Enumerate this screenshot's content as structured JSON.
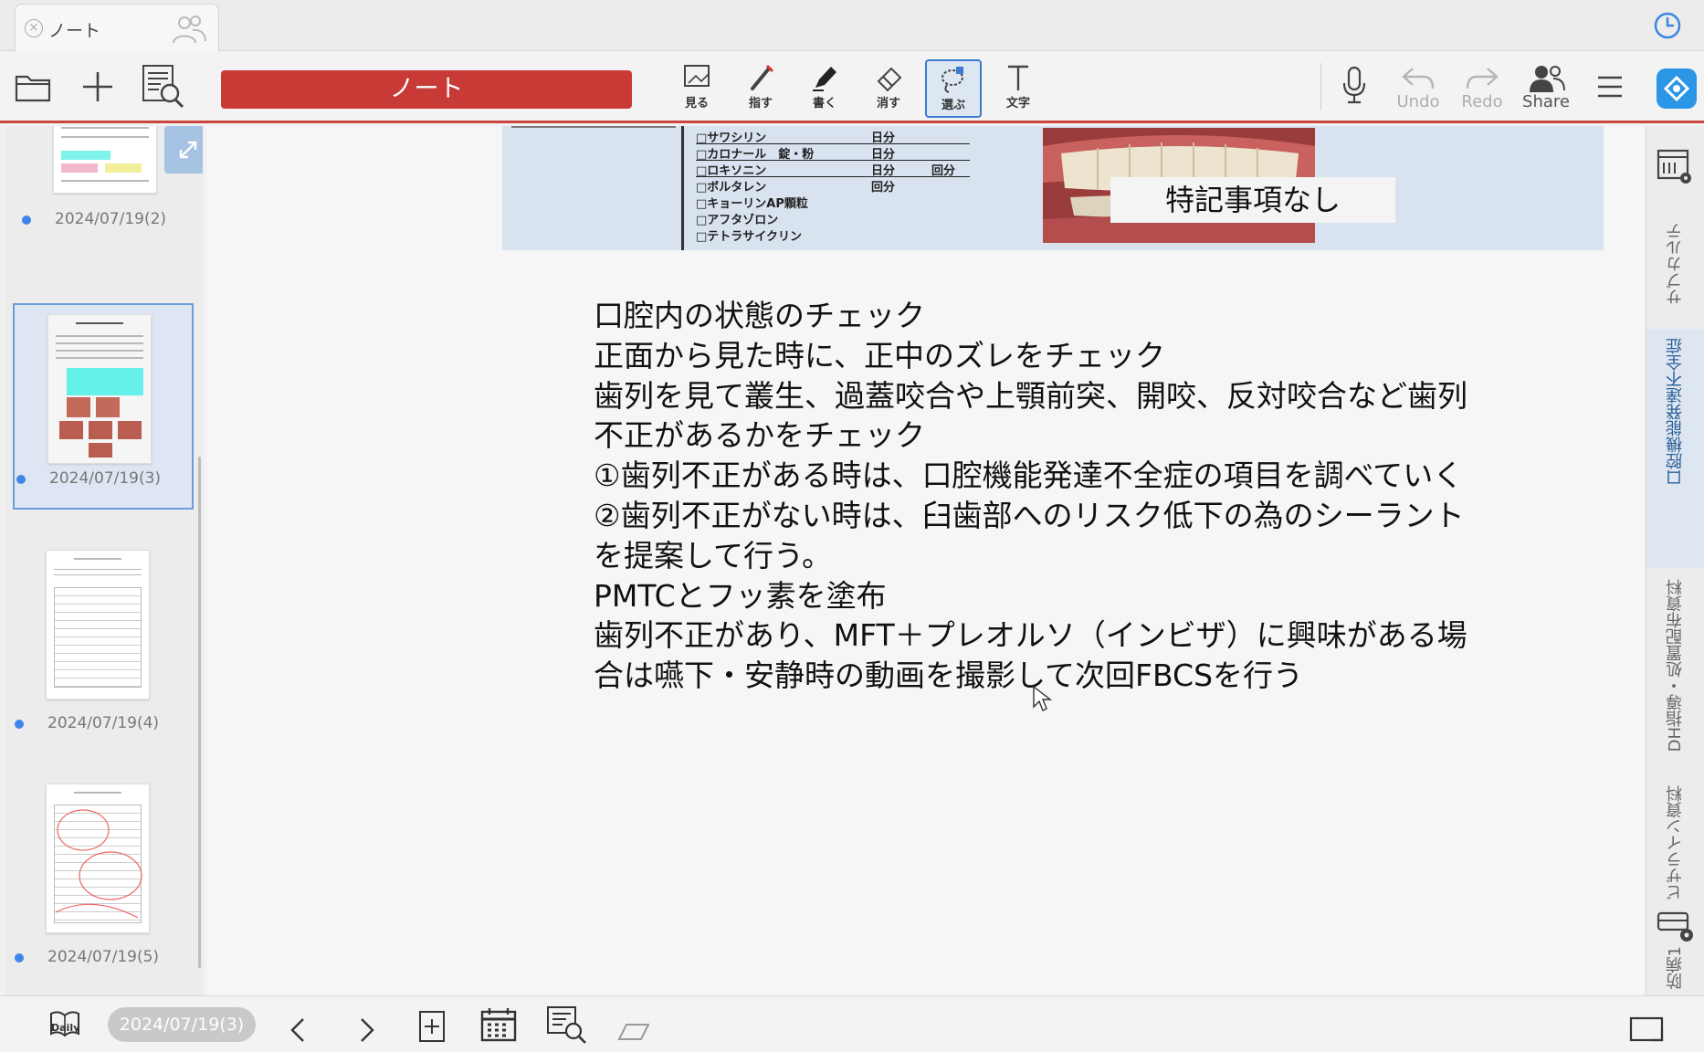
{
  "tab": {
    "title": "ノート"
  },
  "toolbar": {
    "notebook_label": "ノート",
    "tools": [
      {
        "label": "見る",
        "icon": "view-icon"
      },
      {
        "label": "指す",
        "icon": "laser-pointer-icon"
      },
      {
        "label": "書く",
        "icon": "pen-icon"
      },
      {
        "label": "消す",
        "icon": "eraser-icon"
      },
      {
        "label": "選ぶ",
        "icon": "lasso-select-icon",
        "active": true
      },
      {
        "label": "文字",
        "icon": "text-icon"
      }
    ],
    "undo_label": "Undo",
    "redo_label": "Redo",
    "share_label": "Share"
  },
  "sidebar": {
    "pages": [
      {
        "date": "2024/07/19(2)"
      },
      {
        "date": "2024/07/19(3)",
        "selected": true
      },
      {
        "date": "2024/07/19(4)"
      },
      {
        "date": "2024/07/19(5)"
      }
    ]
  },
  "canvas": {
    "meds": [
      {
        "name": "□サワシリン",
        "c2": "日分",
        "c3": ""
      },
      {
        "name": "□カロナール　錠・粉",
        "c2": "日分",
        "c3": ""
      },
      {
        "name": "□ロキソニン",
        "c2": "日分",
        "c3": "回分"
      },
      {
        "name": "□ボルタレン",
        "c2": "回分",
        "c3": ""
      },
      {
        "name": "□キョーリンAP顆粒",
        "c2": "",
        "c3": ""
      },
      {
        "name": "□アフタゾロン",
        "c2": "",
        "c3": ""
      },
      {
        "name": "□テトラサイクリン",
        "c2": "",
        "c3": ""
      }
    ],
    "note_box": "特記事項なし",
    "lines": [
      "口腔内の状態のチェック",
      "正面から見た時に、正中のズレをチェック",
      "歯列を見て叢生、過蓋咬合や上顎前突、開咬、反対咬合など歯列",
      "不正があるかをチェック",
      "①歯列不正がある時は、口腔機能発達不全症の項目を調べていく",
      "②歯列不正がない時は、臼歯部へのリスク低下の為のシーラント",
      "を提案して行う。",
      "PMTCとフッ素を塗布",
      "歯列不正があり、MFT＋プレオルソ（インビザ）に興味がある場",
      "合は嚥下・安静時の動画を撮影して次回FBCSを行う"
    ]
  },
  "rail": {
    "tabs": [
      "サブカルテ",
      "口腔機能発達不全症",
      "DH指導・処置配布資料",
      "ビザライン資料",
      "防病1"
    ]
  },
  "bottom": {
    "daily_label": "Daily",
    "current_page": "2024/07/19(3)"
  },
  "colors": {
    "accent_red": "#c83a36",
    "select_blue": "#3c7bd0",
    "rail_active": "#dde6f1"
  }
}
